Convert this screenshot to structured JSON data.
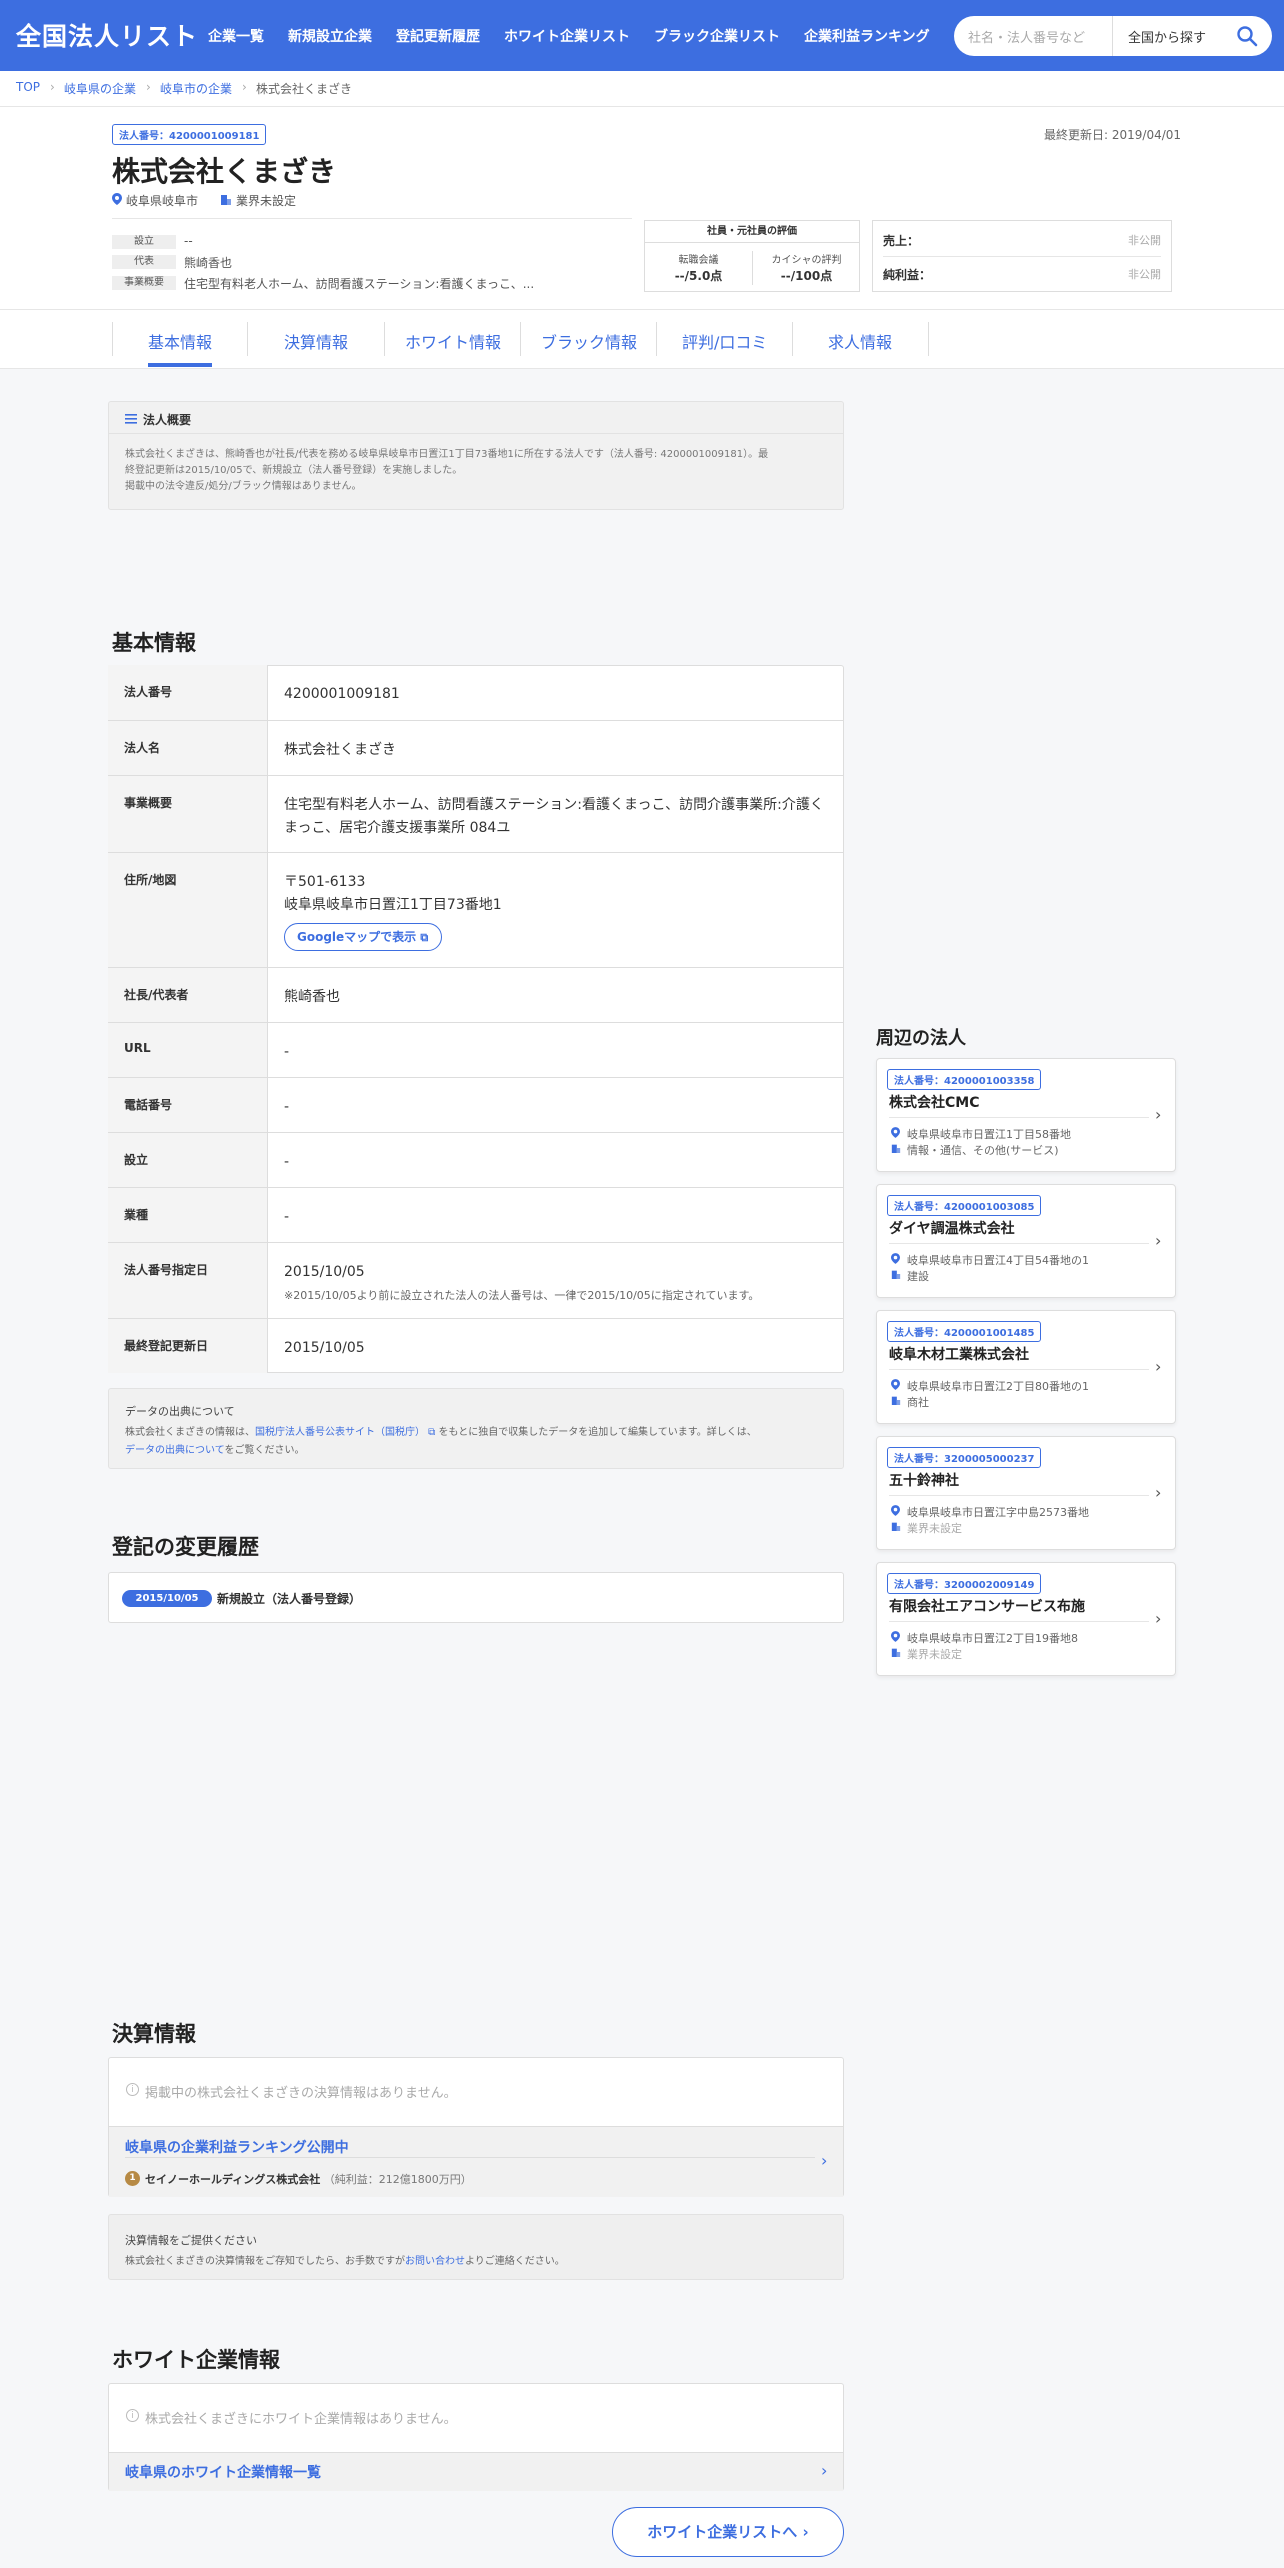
{
  "header": {
    "logo": "全国法人リスト",
    "nav": [
      "企業一覧",
      "新規設立企業",
      "登記更新履歴",
      "ホワイト企業リスト",
      "ブラック企業リスト",
      "企業利益ランキング"
    ],
    "search_placeholder": "社名・法人番号など",
    "search_scope": "全国から探す"
  },
  "breadcrumb": {
    "items": [
      "TOP",
      "岐阜県の企業",
      "岐阜市の企業"
    ],
    "current": "株式会社くまざき"
  },
  "hero": {
    "corp_number_badge": "法人番号：4200001009181",
    "last_updated": "最終更新日: 2019/04/01",
    "name": "株式会社くまざき",
    "location": "岐阜県岐阜市",
    "industry": "業界未設定",
    "facts": [
      {
        "label": "設立",
        "value": "--"
      },
      {
        "label": "代表",
        "value": "熊崎香也"
      },
      {
        "label": "事業概要",
        "value": "住宅型有料老人ホーム、訪問看護ステーション:看護くまっこ、..."
      }
    ],
    "rating": {
      "title": "社員・元社員の評価",
      "left_label": "転職会議",
      "left_value": "--/5.0点",
      "right_label": "カイシャの評判",
      "right_value": "--/100点"
    },
    "finance": {
      "sales_label": "売上：",
      "sales_value": "非公開",
      "profit_label": "純利益：",
      "profit_value": "非公開"
    }
  },
  "tabs": [
    "基本情報",
    "決算情報",
    "ホワイト情報",
    "ブラック情報",
    "評判/口コミ",
    "求人情報"
  ],
  "summary": {
    "title": "法人概要",
    "text": [
      "株式会社くまざきは、熊崎香也が社長/代表を務める岐阜県岐阜市日置江1丁目73番地1に所在する法人です（法人番号: 4200001009181）。最",
      "終登記更新は2015/10/05で、新規設立（法人番号登録）を実施しました。",
      "掲載中の法令違反/処分/ブラック情報はありません。"
    ]
  },
  "basic": {
    "title": "基本情報",
    "rows": [
      {
        "label": "法人番号",
        "value": "4200001009181"
      },
      {
        "label": "法人名",
        "value": "株式会社くまざき"
      },
      {
        "label": "事業概要",
        "value1": "住宅型有料老人ホーム、訪問看護ステーション:看護くまっこ、訪問介護事業所:介護く",
        "value2": "まっこ、居宅介護支援事業所 084ユ"
      },
      {
        "label": "住所/地図",
        "value1": "〒501-6133",
        "value2": "岐阜県岐阜市日置江1丁目73番地1",
        "button": "Googleマップで表示"
      },
      {
        "label": "社長/代表者",
        "value": "熊崎香也"
      },
      {
        "label": "URL",
        "value": "-"
      },
      {
        "label": "電話番号",
        "value": "-"
      },
      {
        "label": "設立",
        "value": "-"
      },
      {
        "label": "業種",
        "value": "-"
      },
      {
        "label": "法人番号指定日",
        "value": "2015/10/05",
        "note": "※2015/10/05より前に設立された法人の法人番号は、一律で2015/10/05に指定されています。"
      },
      {
        "label": "最終登記更新日",
        "value": "2015/10/05"
      }
    ]
  },
  "source": {
    "title": "データの出典について",
    "line1a": "株式会社くまざきの情報は、",
    "link1": "国税庁法人番号公表サイト（国税庁）",
    "line1b": "をもとに独自で収集したデータを追加して編集しています。詳しくは、",
    "link2": "データの出典について",
    "line2b": "をご覧ください。"
  },
  "history": {
    "title": "登記の変更履歴",
    "date": "2015/10/05",
    "event": "新規設立（法人番号登録）"
  },
  "nearby": {
    "title": "周辺の法人",
    "items": [
      {
        "badge": "法人番号：4200001003358",
        "name": "株式会社CMC",
        "address": "岐阜県岐阜市日置江1丁目58番地",
        "industry": "情報・通信、その他(サービス)"
      },
      {
        "badge": "法人番号：4200001003085",
        "name": "ダイヤ調温株式会社",
        "address": "岐阜県岐阜市日置江4丁目54番地の1",
        "industry": "建設"
      },
      {
        "badge": "法人番号：4200001001485",
        "name": "岐阜木材工業株式会社",
        "address": "岐阜県岐阜市日置江2丁目80番地の1",
        "industry": "商社"
      },
      {
        "badge": "法人番号：3200005000237",
        "name": "五十鈴神社",
        "address": "岐阜県岐阜市日置江字中島2573番地",
        "industry": "業界未設定"
      },
      {
        "badge": "法人番号：3200002009149",
        "name": "有限会社エアコンサービス布施",
        "address": "岐阜県岐阜市日置江2丁目19番地8",
        "industry": "業界未設定"
      }
    ]
  },
  "settlement": {
    "title": "決算情報",
    "empty": "掲載中の株式会社くまざきの決算情報はありません。",
    "ranking_link": "岐阜県の企業利益ランキング公開中",
    "rank_num": "1",
    "rank_company": "セイノーホールディングス株式会社",
    "rank_detail": "（純利益：212億1800万円）",
    "request_title": "決算情報をご提供ください",
    "request_a": "株式会社くまざきの決算情報をご存知でしたら、お手数ですが",
    "request_link": "お問い合わせ",
    "request_b": "よりご連絡ください。"
  },
  "white": {
    "title": "ホワイト企業情報",
    "empty": "株式会社くまざきにホワイト企業情報はありません。",
    "list_link": "岐阜県のホワイト企業情報一覧",
    "button": "ホワイト企業リストへ"
  },
  "colors": {
    "primary": "#3d6ee0",
    "background": "#f6f7f9"
  }
}
